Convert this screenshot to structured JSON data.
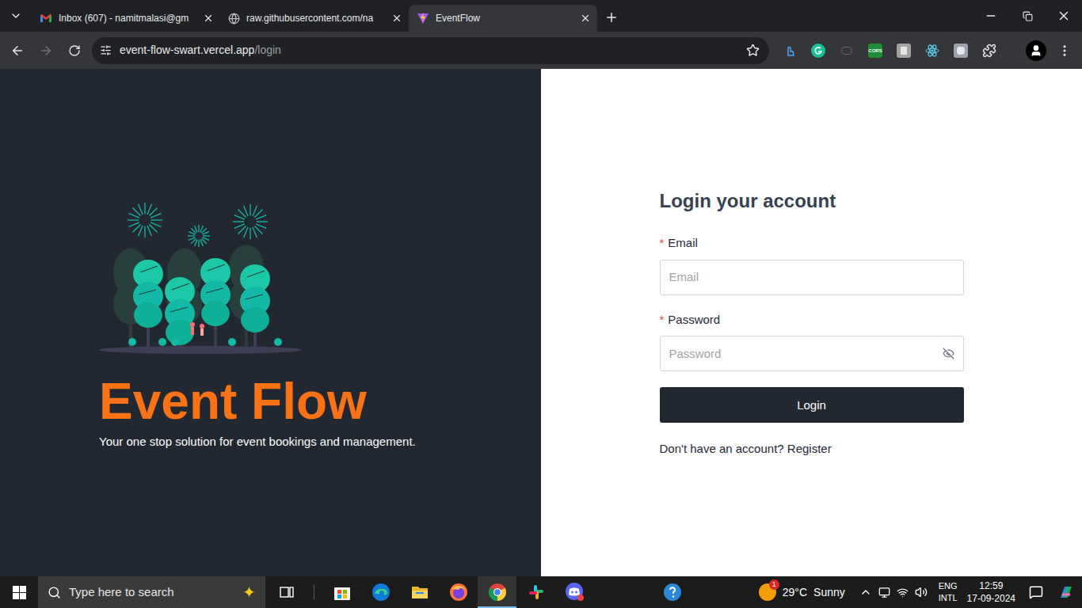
{
  "browser": {
    "tabs": [
      {
        "label": "Inbox (607) - namitmalasi@gm",
        "favicon": "gmail",
        "selected": false
      },
      {
        "label": "raw.githubusercontent.com/na",
        "favicon": "globe",
        "selected": false
      },
      {
        "label": "EventFlow",
        "favicon": "vite",
        "selected": true
      }
    ],
    "address": {
      "host": "event-flow-swart.vercel.app",
      "path": "/login"
    },
    "bookmarked": false,
    "extensions": [
      {
        "kind": "touch",
        "label": ""
      },
      {
        "kind": "grammarly",
        "label": ""
      },
      {
        "kind": "pill",
        "label": ""
      },
      {
        "kind": "badge",
        "label": "CORS"
      },
      {
        "kind": "square",
        "label": ""
      },
      {
        "kind": "react",
        "label": ""
      },
      {
        "kind": "tile",
        "label": ""
      },
      {
        "kind": "puzzle",
        "label": ""
      }
    ]
  },
  "brand": {
    "title": "Event Flow",
    "tagline": "Your one stop solution for event bookings and management."
  },
  "form": {
    "title": "Login your account",
    "required_mark": "*",
    "fields": [
      {
        "label": "Email",
        "placeholder": "Email",
        "required": true,
        "kind": "text"
      },
      {
        "label": "Password",
        "placeholder": "Password",
        "required": true,
        "kind": "password"
      }
    ],
    "button": "Login",
    "prompt": "Don't have an account?",
    "link": "Register"
  },
  "taskbar": {
    "search": {
      "placeholder": "Type here to search"
    },
    "apps": [
      {
        "kind": "taskview",
        "running": false,
        "active": false
      },
      {
        "kind": "store",
        "running": false,
        "active": false
      },
      {
        "kind": "edge",
        "running": false,
        "active": false
      },
      {
        "kind": "explorer",
        "running": false,
        "active": false
      },
      {
        "kind": "firefox",
        "running": false,
        "active": false
      },
      {
        "kind": "chrome",
        "running": true,
        "active": true
      },
      {
        "kind": "slack",
        "running": false,
        "active": false
      },
      {
        "kind": "discord",
        "running": false,
        "active": false
      },
      {
        "kind": "help",
        "running": false,
        "active": false
      }
    ],
    "weather": {
      "badge": "1",
      "temp": "29°C",
      "condition": "Sunny"
    },
    "language": {
      "lang": "ENG",
      "layout": "INTL"
    },
    "clock": {
      "time": "12:59",
      "date": "17-09-2024"
    }
  }
}
